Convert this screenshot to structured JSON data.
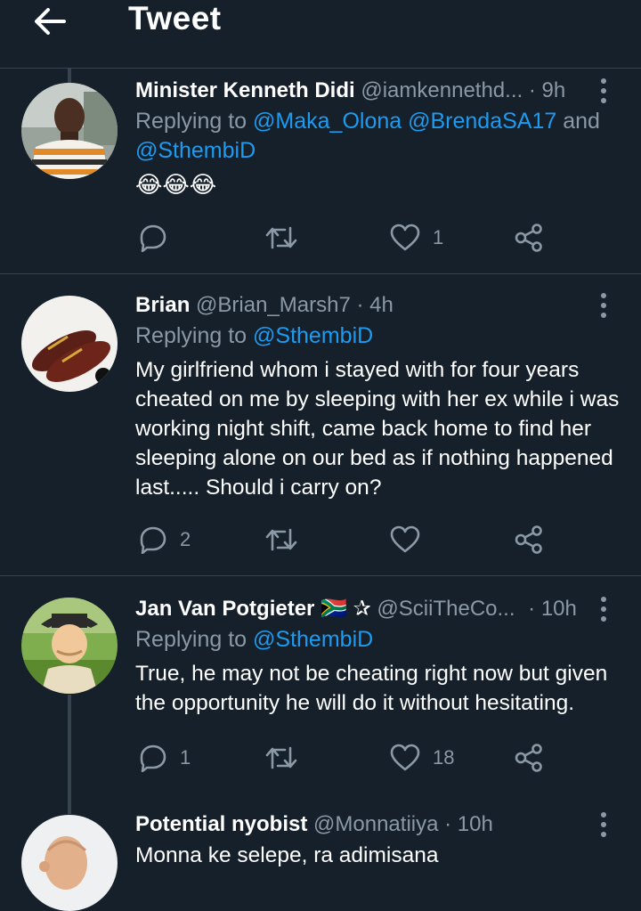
{
  "header": {
    "title": "Tweet"
  },
  "tweets": [
    {
      "name": "Minister Kenneth Didi",
      "handle": "@iamkennethd...",
      "time": "· 9h",
      "replying_prefix": "Replying to ",
      "replying_to": "@Maka_Olona @BrendaSA17",
      "replying_and": " and",
      "replying_to_2": "@SthembiD",
      "text": "😂😂😂",
      "replies": "",
      "likes": "1"
    },
    {
      "name": "Brian",
      "handle": "@Brian_Marsh7",
      "time": "· 4h",
      "replying_prefix": "Replying to ",
      "replying_to": "@SthembiD",
      "text": "My girlfriend whom i stayed with for four years cheated on me by sleeping with her ex while i was working night shift, came back home to find her sleeping alone on our bed as if nothing happened last..... Should i carry on?",
      "replies": "2",
      "likes": ""
    },
    {
      "name": "Jan Van Potgieter",
      "name_badges": "🇿🇦 ✰",
      "handle": "@SciiTheCo...",
      "time": "· 10h",
      "replying_prefix": "Replying to ",
      "replying_to": "@SthembiD",
      "text": "True, he may not be cheating right now but given the opportunity he will do it without hesitating.",
      "replies": "1",
      "likes": "18"
    },
    {
      "name": "Potential nyobist",
      "handle": "@Monnatiiya",
      "time": "· 10h",
      "text": "Monna ke selepe, ra adimisana"
    }
  ],
  "colors": {
    "background": "#15202b",
    "link": "#1d9bf0",
    "muted": "#8b98a5",
    "divider": "#38444d"
  },
  "icons": [
    "back-arrow-icon",
    "more-vertical-icon",
    "reply-icon",
    "retweet-icon",
    "like-icon",
    "share-icon"
  ]
}
